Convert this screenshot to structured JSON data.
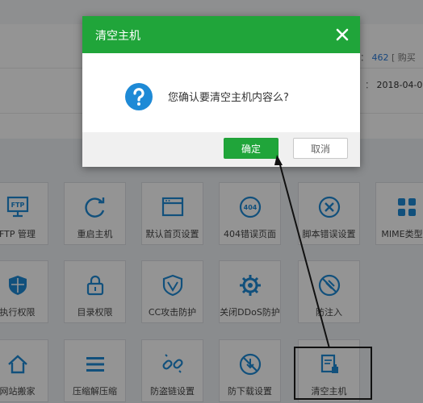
{
  "colors": {
    "accent_green": "#20a53a",
    "link_blue": "#2a7ad8",
    "icon_blue": "#1e8ad6",
    "overlay": "rgba(0,0,0,0.42)"
  },
  "info_panel": {
    "count_value": "462",
    "count_suffix": "[ 购买",
    "date_value": "2018-04-0",
    "sep1": "：",
    "sep2": "："
  },
  "tiles": [
    {
      "label": "FTP 管理",
      "icon": "ftp-icon"
    },
    {
      "label": "重启主机",
      "icon": "restart-icon"
    },
    {
      "label": "默认首页设置",
      "icon": "homepage-icon"
    },
    {
      "label": "404错误页面",
      "icon": "error-404-icon"
    },
    {
      "label": "脚本错误设置",
      "icon": "script-error-icon"
    },
    {
      "label": "MIME类型设",
      "icon": "mime-grid-icon"
    },
    {
      "label": "执行权限",
      "icon": "shield-icon"
    },
    {
      "label": "目录权限",
      "icon": "lock-icon"
    },
    {
      "label": "CC攻击防护",
      "icon": "cc-shield-icon"
    },
    {
      "label": "关闭DDoS防护",
      "icon": "ddos-gear-icon"
    },
    {
      "label": "防注入",
      "icon": "anti-injection-icon"
    },
    {
      "label": "网站搬家",
      "icon": "home-icon"
    },
    {
      "label": "压缩解压缩",
      "icon": "menu-icon"
    },
    {
      "label": "防盗链设置",
      "icon": "link-break-icon"
    },
    {
      "label": "防下载设置",
      "icon": "no-download-icon"
    },
    {
      "label": "清空主机",
      "icon": "clear-host-icon"
    }
  ],
  "dialog": {
    "title": "清空主机",
    "message": "您确认要清空主机内容么?",
    "ok_label": "确定",
    "cancel_label": "取消",
    "icon": "question-icon",
    "close_icon": "close-icon"
  }
}
